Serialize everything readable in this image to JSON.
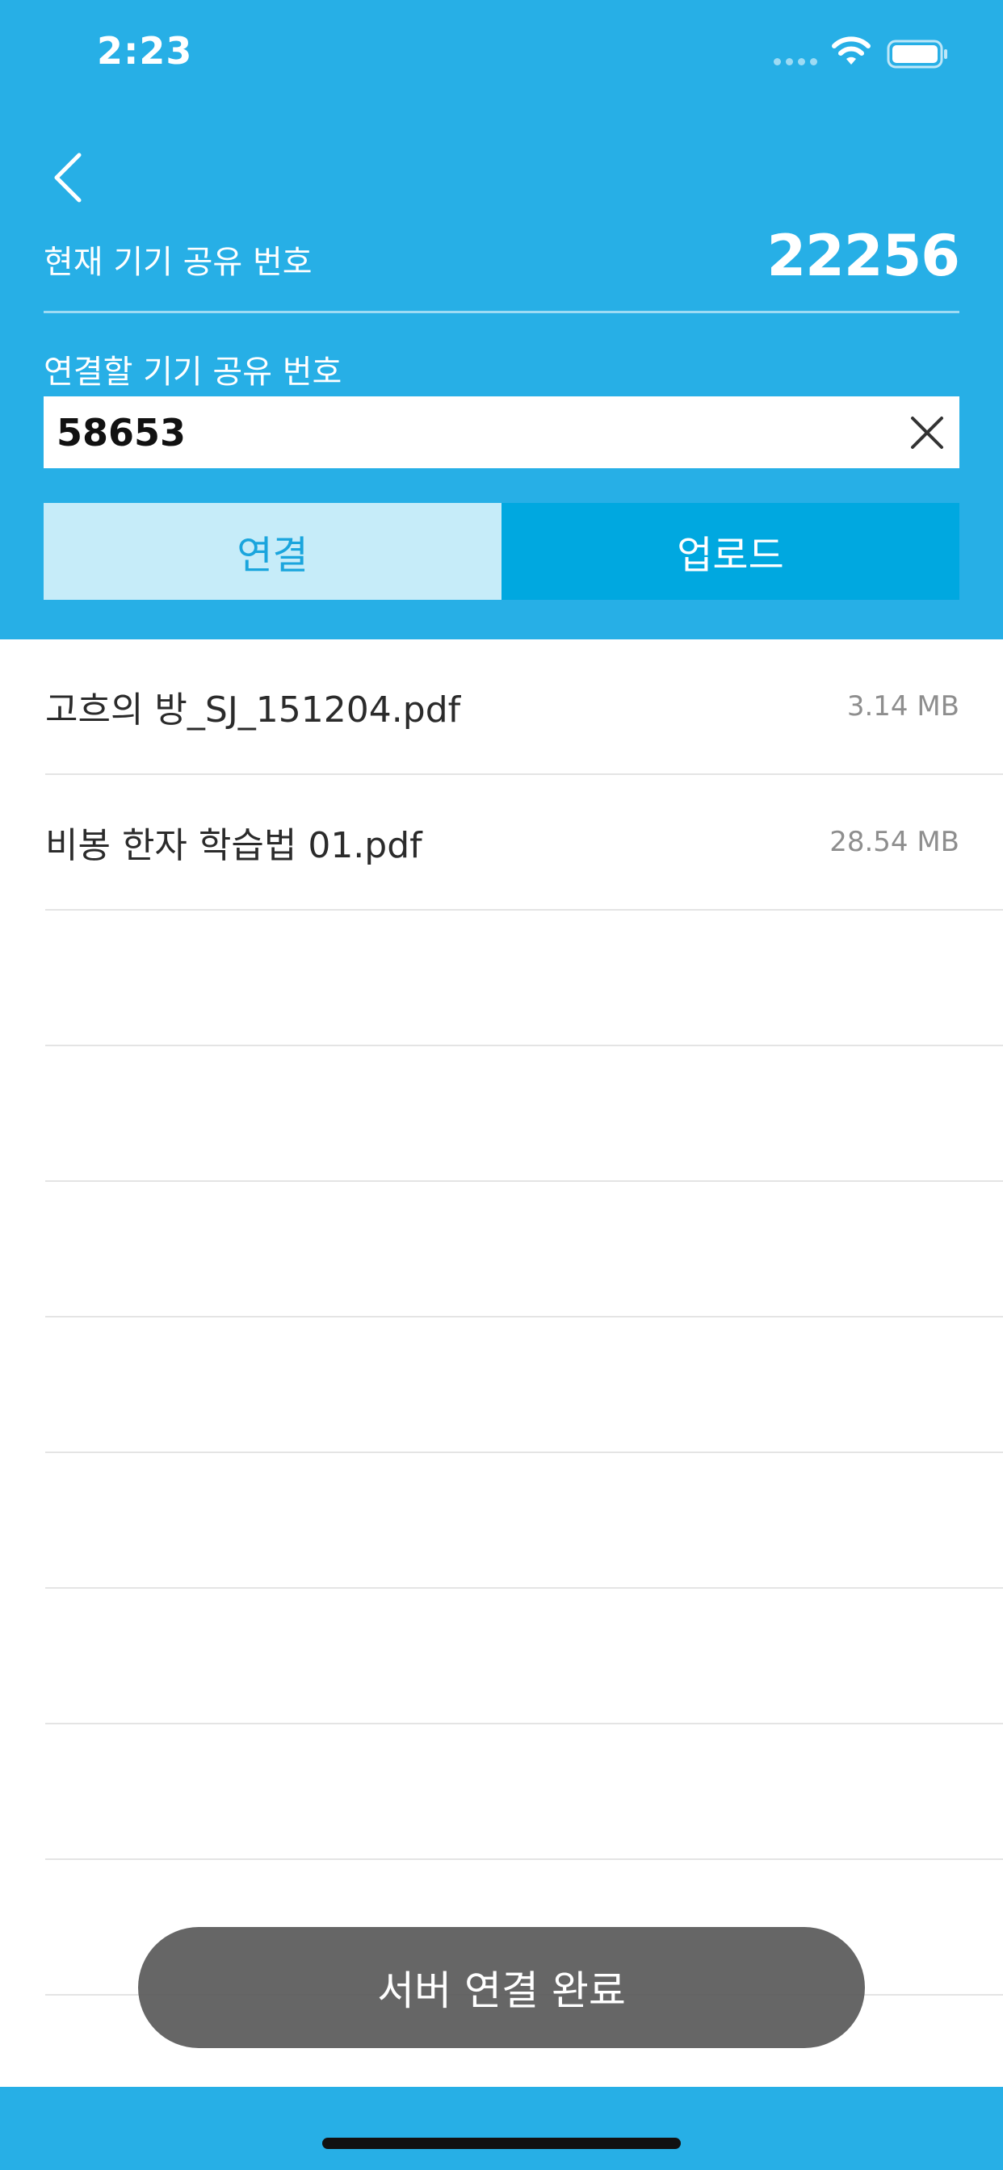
{
  "status_bar": {
    "time": "2:23"
  },
  "header": {
    "current_label": "현재 기기 공유 번호",
    "current_number": "22256",
    "target_label": "연결할 기기 공유 번호",
    "target_input_value": "58653",
    "connect_label": "연결",
    "upload_label": "업로드",
    "accent_color": "#27afe6"
  },
  "files": [
    {
      "name": "고흐의 방_SJ_151204.pdf",
      "size": "3.14 MB"
    },
    {
      "name": "비봉 한자 학습법 01.pdf",
      "size": "28.54 MB"
    }
  ],
  "toast": {
    "message": "서버 연결 완료"
  }
}
